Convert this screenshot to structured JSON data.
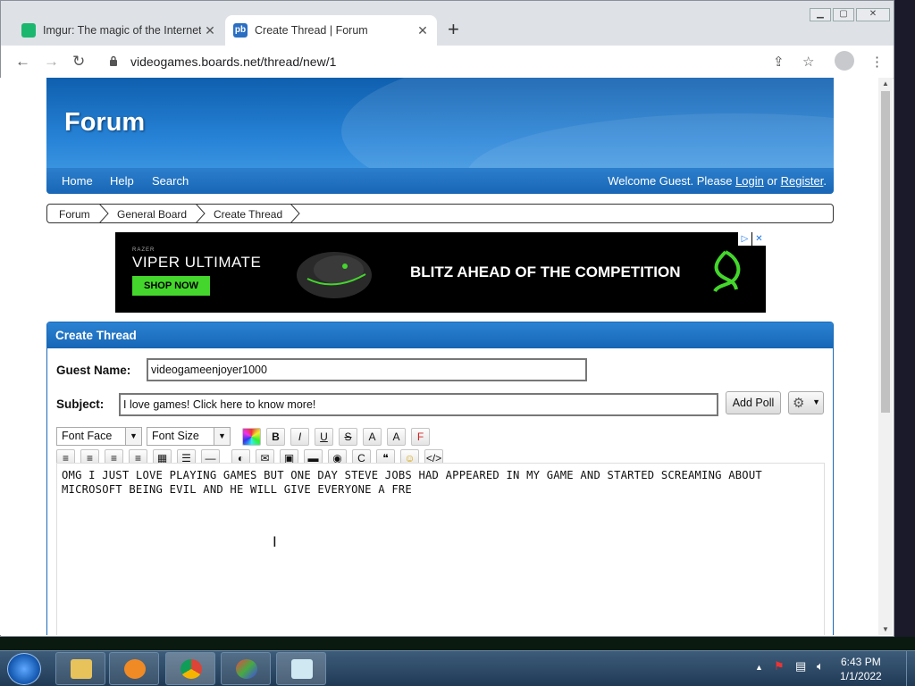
{
  "browser": {
    "tabs": [
      {
        "title": "Imgur: The magic of the Internet"
      },
      {
        "title": "Create Thread | Forum"
      }
    ],
    "url": "videogames.boards.net/thread/new/1"
  },
  "forum": {
    "logo": "Forum",
    "nav": [
      "Home",
      "Help",
      "Search"
    ],
    "welcome_prefix": "Welcome Guest. Please ",
    "login": "Login",
    "or": " or ",
    "register": "Register",
    "period": "."
  },
  "breadcrumb": [
    "Forum",
    "General Board",
    "Create Thread"
  ],
  "ad": {
    "brand": "RAZER",
    "product": "VIPER ULTIMATE",
    "cta": "SHOP NOW",
    "headline": "BLITZ AHEAD OF THE COMPETITION"
  },
  "form": {
    "title": "Create Thread",
    "guest_label": "Guest Name:",
    "guest_value": "videogameenjoyer1000",
    "subject_label": "Subject:",
    "subject_value": "I love games! Click here to know more!",
    "add_poll": "Add Poll",
    "font_face": "Font Face",
    "font_size": "Font Size",
    "body_text": "OMG I JUST LOVE PLAYING GAMES BUT ONE DAY STEVE JOBS HAD APPEARED IN MY GAME AND STARTED SCREAMING ABOUT MICROSOFT BEING EVIL AND HE WILL GIVE EVERYONE A FRE"
  },
  "editor_icons": {
    "row1": [
      "color-picker-icon",
      "bold-icon",
      "italic-icon",
      "underline-icon",
      "strikethrough-icon",
      "superscript-icon",
      "subscript-icon",
      "clear-format-icon"
    ],
    "row1_glyphs": [
      "",
      "B",
      "I",
      "U",
      "S",
      "A",
      "A",
      "F"
    ],
    "row2": [
      "align-left-icon",
      "align-center-icon",
      "align-right-icon",
      "justify-icon",
      "table-icon",
      "list-icon",
      "horizontal-rule-icon",
      "link-icon",
      "email-icon",
      "image-icon",
      "video-icon",
      "share-icon",
      "code-icon",
      "quote-icon",
      "emoji-icon",
      "html-icon"
    ],
    "row2_glyphs": [
      "≡",
      "≡",
      "≡",
      "≡",
      "▦",
      "☰",
      "—",
      "◐",
      "✉",
      "▣",
      "▬",
      "◉",
      "C",
      "❝",
      "☺",
      "</>"
    ]
  },
  "taskbar": {
    "time": "6:43 PM",
    "date": "1/1/2022"
  },
  "colors": {
    "forum_blue": "#1a6ab8",
    "razer_green": "#44d62c"
  }
}
